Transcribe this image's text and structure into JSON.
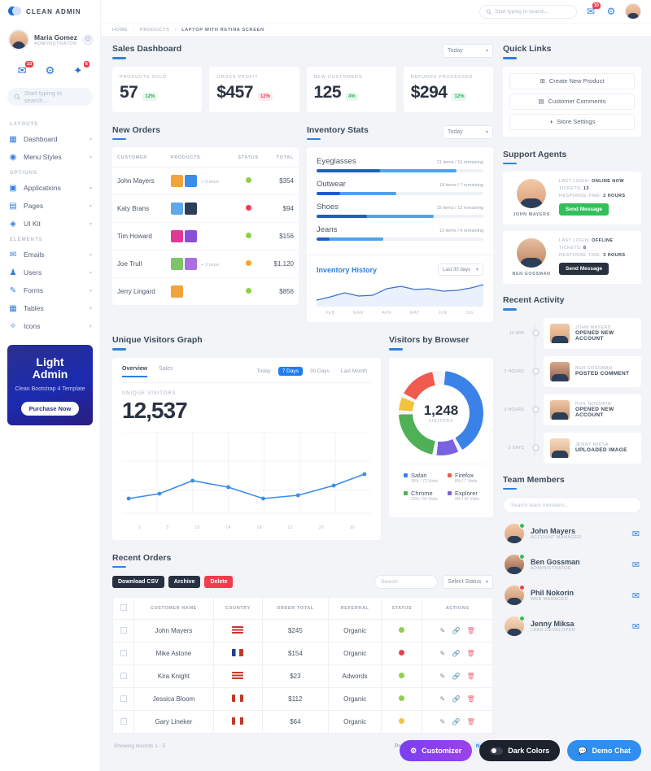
{
  "brand": {
    "name": "CLEAN ADMIN"
  },
  "profile": {
    "name": "Maria Gomez",
    "role": "ADMINISTRATOR",
    "power_icon": "power-icon"
  },
  "sidebar": {
    "quick_icons": [
      {
        "icon": "messages-icon",
        "badge": "10"
      },
      {
        "icon": "gear-icon",
        "badge": ""
      },
      {
        "icon": "rocket-icon",
        "badge": "6"
      }
    ],
    "search_placeholder": "Start typing to search...",
    "sections": [
      {
        "label": "LAYOUTS",
        "items": [
          {
            "icon": "dashboard-icon",
            "label": "Dashboard"
          },
          {
            "icon": "menu-styles-icon",
            "label": "Menu Styles"
          }
        ]
      },
      {
        "label": "OPTIONS",
        "items": [
          {
            "icon": "applications-icon",
            "label": "Applications"
          },
          {
            "icon": "pages-icon",
            "label": "Pages"
          },
          {
            "icon": "uikit-icon",
            "label": "UI Kit"
          }
        ]
      },
      {
        "label": "ELEMENTS",
        "items": [
          {
            "icon": "email-icon",
            "label": "Emails"
          },
          {
            "icon": "users-icon",
            "label": "Users"
          },
          {
            "icon": "forms-icon",
            "label": "Forms"
          },
          {
            "icon": "tables-icon",
            "label": "Tables"
          },
          {
            "icon": "icons-icon",
            "label": "Icons"
          }
        ]
      }
    ],
    "promo": {
      "title_line1": "Light",
      "title_line2": "Admin",
      "subtitle": "Clean Bootstrap 4 Template",
      "button": "Purchase Now"
    }
  },
  "topbar": {
    "search_placeholder": "Start typing to search...",
    "messages_icon": "messages-icon",
    "messages_badge": "10",
    "settings_icon": "gear-icon",
    "avatar": "user-avatar"
  },
  "breadcrumb": {
    "home": "HOME",
    "products": "PRODUCTS",
    "current": "LAPTOP WITH RETINA SCREEN"
  },
  "sales": {
    "title": "Sales Dashboard",
    "period": "Today",
    "cards": [
      {
        "label": "PRODUCTS SOLD",
        "value": "57",
        "change": "12%",
        "dir": "up"
      },
      {
        "label": "GROSS PROFIT",
        "value": "$457",
        "change": "12%",
        "dir": "down"
      },
      {
        "label": "NEW CUSTOMERS",
        "value": "125",
        "change": "4%",
        "dir": "up"
      },
      {
        "label": "REFUNDS PROCESSED",
        "value": "$294",
        "change": "12%",
        "dir": "up"
      }
    ]
  },
  "new_orders": {
    "title": "New Orders",
    "columns": [
      "CUSTOMER",
      "PRODUCTS",
      "STATUS",
      "TOTAL"
    ],
    "rows": [
      {
        "customer": "John Mayers",
        "extra": "+ 3 more",
        "status": "green",
        "total": "$354",
        "swatches": [
          "#f2a33c",
          "#3b8ee8"
        ]
      },
      {
        "customer": "Katy Brans",
        "extra": "",
        "status": "red",
        "total": "$94",
        "swatches": [
          "#5fa8e8",
          "#2c3e58"
        ]
      },
      {
        "customer": "Tim Howard",
        "extra": "",
        "status": "green",
        "total": "$156",
        "swatches": [
          "#e0399a",
          "#8a4fd6"
        ]
      },
      {
        "customer": "Joe Trull",
        "extra": "+ 2 more",
        "status": "orange",
        "total": "$1,120",
        "swatches": [
          "#7ec46a",
          "#a96fe0"
        ]
      },
      {
        "customer": "Jerry Lingard",
        "extra": "",
        "status": "green",
        "total": "$856",
        "swatches": [
          "#f2a33c",
          "#4fb056"
        ]
      }
    ]
  },
  "inventory": {
    "title": "Inventory Stats",
    "period": "Today",
    "rows": [
      {
        "name": "Eyeglasses",
        "meta": "21 items / 10 remaining",
        "dark_pct": 38,
        "light_pct": 84
      },
      {
        "name": "Outwear",
        "meta": "18 items / 7 remaining",
        "dark_pct": 14,
        "light_pct": 48
      },
      {
        "name": "Shoes",
        "meta": "15 items / 12 remaining",
        "dark_pct": 30,
        "light_pct": 70
      },
      {
        "name": "Jeans",
        "meta": "12 items / 4 remaining",
        "dark_pct": 8,
        "light_pct": 40
      }
    ],
    "history": {
      "title": "Inventory History",
      "range": "Last 30 days",
      "xlabels": [
        "FEB",
        "MAR",
        "APR",
        "MAY",
        "JUN",
        "JUL"
      ]
    }
  },
  "visitors_graph": {
    "title": "Unique Visitors Graph",
    "tabs": [
      {
        "label": "Overview",
        "active": true
      },
      {
        "label": "Sales",
        "active": false
      }
    ],
    "filters": [
      {
        "label": "Today",
        "active": false
      },
      {
        "label": "7 Days",
        "active": true
      },
      {
        "label": "30 Days",
        "active": false
      },
      {
        "label": "Last Month",
        "active": false
      }
    ],
    "metric_label": "UNIQUE VISITORS",
    "metric_value": "12,537",
    "xlabels": [
      "1",
      "5",
      "10",
      "14",
      "18",
      "22",
      "26",
      "30"
    ]
  },
  "browsers": {
    "title": "Visitors by Browser",
    "center_value": "1,248",
    "center_label": "VISITORS",
    "legend": [
      {
        "name": "Safari",
        "stat": "19% / 72 Visits",
        "color": "#3b82e8"
      },
      {
        "name": "Firefox",
        "stat": "8% / 7 Visits",
        "color": "#ef5b4e"
      },
      {
        "name": "Chrome",
        "stat": "23% / 93 Visits",
        "color": "#4fb056"
      },
      {
        "name": "Explorer",
        "stat": "9% / 42 Visits",
        "color": "#7b62e0"
      }
    ]
  },
  "recent_orders": {
    "title": "Recent Orders",
    "buttons": {
      "csv": "Download CSV",
      "archive": "Archive",
      "delete": "Delete"
    },
    "search_placeholder": "Search:",
    "status_filter": "Select Status",
    "columns": [
      "",
      "CUSTOMER NAME",
      "COUNTRY",
      "ORDER TOTAL",
      "REFERRAL",
      "STATUS",
      "ACTIONS"
    ],
    "rows": [
      {
        "name": "John Mayers",
        "country": "US",
        "total": "$245",
        "referral": "Organic",
        "status": "green"
      },
      {
        "name": "Mike Astone",
        "country": "FR",
        "total": "$154",
        "referral": "Organic",
        "status": "red"
      },
      {
        "name": "Kira Knight",
        "country": "US",
        "total": "$23",
        "referral": "Adwords",
        "status": "green"
      },
      {
        "name": "Jessica Bloom",
        "country": "CA",
        "total": "$112",
        "referral": "Organic",
        "status": "green"
      },
      {
        "name": "Gary Lineker",
        "country": "CA",
        "total": "$64",
        "referral": "Organic",
        "status": "yellow"
      }
    ],
    "showing": "Showing records 1 - 5",
    "pagination": {
      "previous": "Previous",
      "pages": [
        "1",
        "2",
        "3",
        "4"
      ],
      "next": "Next",
      "active": "4"
    }
  },
  "quick_links": {
    "title": "Quick Links",
    "items": [
      {
        "icon": "add-product-icon",
        "label": "Create New Product"
      },
      {
        "icon": "comments-icon",
        "label": "Customer Comments"
      },
      {
        "icon": "store-settings-icon",
        "label": "Store Settings"
      }
    ]
  },
  "support_agents": {
    "title": "Support Agents",
    "agents": [
      {
        "name": "JOHN MAYERS",
        "last_login_label": "LAST LOGIN:",
        "last_login": "ONLINE NOW",
        "tickets_label": "TICKETS:",
        "tickets": "13",
        "response_label": "RESPONSE TIME:",
        "response": "2 HOURS",
        "button": "Send Message",
        "button_style": "green"
      },
      {
        "name": "BEN GOSSMAN",
        "last_login_label": "LAST LOGIN:",
        "last_login": "OFFLINE",
        "tickets_label": "TICKETS:",
        "tickets": "8",
        "response_label": "RESPONSE TIME:",
        "response": "3 HOURS",
        "button": "Send Message",
        "button_style": "dark"
      }
    ]
  },
  "recent_activity": {
    "title": "Recent Activity",
    "items": [
      {
        "time": "10 MIN",
        "name": "JOHN MAYERS",
        "action": "OPENED NEW ACCOUNT"
      },
      {
        "time": "2 HOURS",
        "name": "BEN GOSSMAN",
        "action": "POSTED COMMENT"
      },
      {
        "time": "3 HOURS",
        "name": "PHIL NOKORIN",
        "action": "OPENED NEW ACCOUNT"
      },
      {
        "time": "2 DAYS",
        "name": "JENNY MIKSA",
        "action": "UPLOADED IMAGE"
      }
    ]
  },
  "team_members": {
    "title": "Team Members",
    "search_placeholder": "Search team members...",
    "members": [
      {
        "name": "John Mayers",
        "role": "ACCOUNT MANAGER",
        "status": "#33c05a"
      },
      {
        "name": "Ben Gossman",
        "role": "ADMINISTRATOR",
        "status": "#33c05a"
      },
      {
        "name": "Phil Nokorin",
        "role": "WEB MANAGER",
        "status": "#ef3d4e"
      },
      {
        "name": "Jenny Miksa",
        "role": "LEAD DEVELOPER",
        "status": "#33c05a"
      }
    ]
  },
  "fabs": [
    {
      "label": "Customizer",
      "icon": "gear-icon",
      "style": "purple"
    },
    {
      "label": "Dark Colors",
      "icon": "toggle-icon",
      "style": "dark"
    },
    {
      "label": "Demo Chat",
      "icon": "chat-icon",
      "style": "blue"
    }
  ]
}
